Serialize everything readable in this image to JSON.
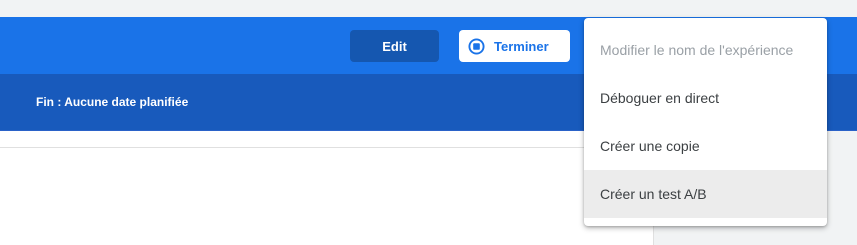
{
  "header": {
    "edit_label": "Edit",
    "end_label": "Terminer",
    "end_icon": "stop-circle-icon",
    "accent_color": "#1a73e8",
    "secondary_color": "#185abc"
  },
  "schedule": {
    "end_text": "Fin : Aucune date planifiée"
  },
  "menu": {
    "items": [
      {
        "label": "Modifier le nom de l'expérience",
        "state": "disabled"
      },
      {
        "label": "Déboguer en direct",
        "state": "normal"
      },
      {
        "label": "Créer une copie",
        "state": "normal"
      },
      {
        "label": "Créer un test A/B",
        "state": "hovered"
      }
    ]
  }
}
